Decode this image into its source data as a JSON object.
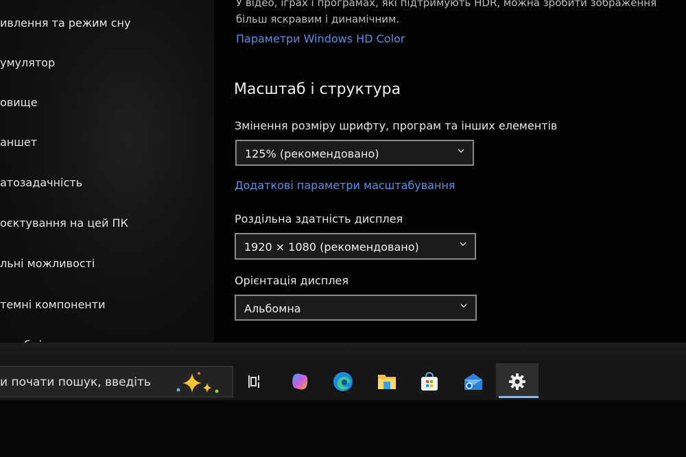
{
  "sidebar": {
    "items": [
      {
        "label": "ивлення та режим сну"
      },
      {
        "label": "умулятор"
      },
      {
        "label": "овище"
      },
      {
        "label": "аншет"
      },
      {
        "label": "атозадачність"
      },
      {
        "label": "оєктування на цей ПК"
      },
      {
        "label": "льні можливості"
      },
      {
        "label": "темні компоненти"
      },
      {
        "label": "ор обміну"
      }
    ]
  },
  "main": {
    "hdr_description": "У відео, іграх і програмах, які підтримують HDR, можна зробити зображення більш яскравим і динамічним.",
    "hdr_link": "Параметри Windows HD Color",
    "section_title": "Масштаб і структура",
    "scale": {
      "label": "Змінення розміру шрифту, програм та інших елементів",
      "value": "125% (рекомендовано)"
    },
    "advanced_scaling_link": "Додаткові параметри масштабування",
    "resolution": {
      "label": "Роздільна здатність дисплея",
      "value": "1920 × 1080 (рекомендовано)"
    },
    "orientation": {
      "label": "Орієнтація дисплея",
      "value": "Альбомна"
    }
  },
  "taskbar": {
    "search_placeholder": "и почати пошук, введіть",
    "icons": [
      "copilot-sparkle-icon",
      "task-view-icon",
      "copilot-icon",
      "edge-icon",
      "file-explorer-icon",
      "store-icon",
      "mail-icon",
      "settings-icon"
    ],
    "active": "settings-icon",
    "accent": "#8fb4e6"
  },
  "colors": {
    "link": "#5b8ee8",
    "background": "#020202"
  }
}
